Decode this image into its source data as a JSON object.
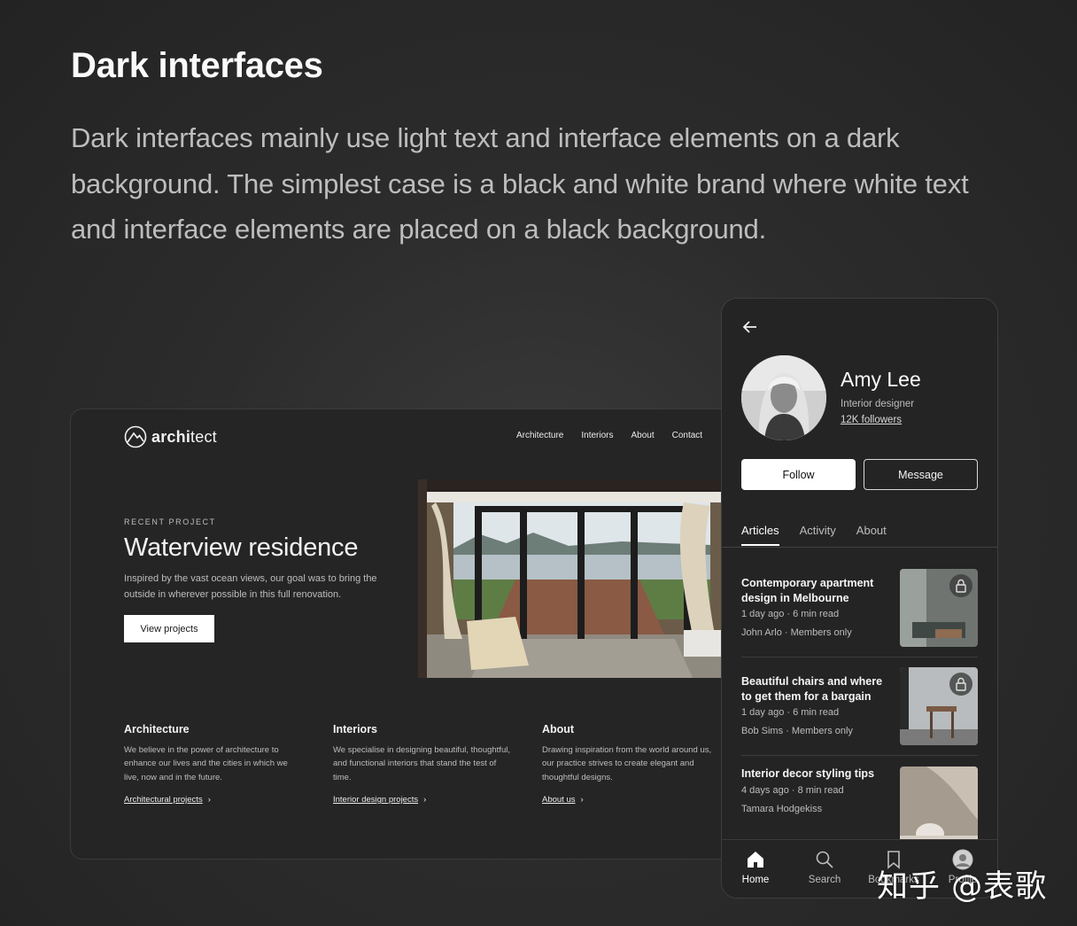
{
  "page": {
    "heading": "Dark interfaces",
    "intro": "Dark interfaces mainly use light text and interface elements on a dark background. The simplest case is a black and white brand where white text and interface elements are placed on a black background."
  },
  "desktop": {
    "logo": {
      "bold": "archi",
      "regular": "tect"
    },
    "nav": [
      "Architecture",
      "Interiors",
      "About",
      "Contact"
    ],
    "hero": {
      "eyebrow": "RECENT PROJECT",
      "title": "Waterview residence",
      "description": "Inspired by the vast ocean views, our goal was to bring the outside in wherever possible in this full renovation.",
      "button": "View projects"
    },
    "columns": [
      {
        "title": "Architecture",
        "text": "We believe in the power of architecture to enhance our lives and the cities in which we live, now and in the future.",
        "link": "Architectural projects"
      },
      {
        "title": "Interiors",
        "text": "We specialise in designing beautiful, thoughtful, and functional interiors that stand the test of time.",
        "link": "Interior design projects"
      },
      {
        "title": "About",
        "text": "Drawing inspiration from the world around us, our practice strives to create elegant and thoughtful designs.",
        "link": "About us"
      }
    ]
  },
  "phone": {
    "profile": {
      "name": "Amy Lee",
      "role": "Interior designer",
      "followers": "12K followers"
    },
    "buttons": {
      "follow": "Follow",
      "message": "Message"
    },
    "tabs": [
      "Articles",
      "Activity",
      "About"
    ],
    "articles": [
      {
        "title": "Contemporary apartment design in Melbourne",
        "time": "1 day ago · 6 min read",
        "author": "John Arlo · Members only"
      },
      {
        "title": "Beautiful chairs and where to get them for a bargain",
        "time": "1 day ago · 6 min read",
        "author": "Bob Sims · Members only"
      },
      {
        "title": "Interior decor styling tips",
        "time": "4 days ago · 8 min read",
        "author": "Tamara Hodgekiss"
      }
    ],
    "bottom_nav": [
      "Home",
      "Search",
      "Bookmarks",
      "Profile"
    ]
  },
  "watermark": "知乎 @表歌"
}
